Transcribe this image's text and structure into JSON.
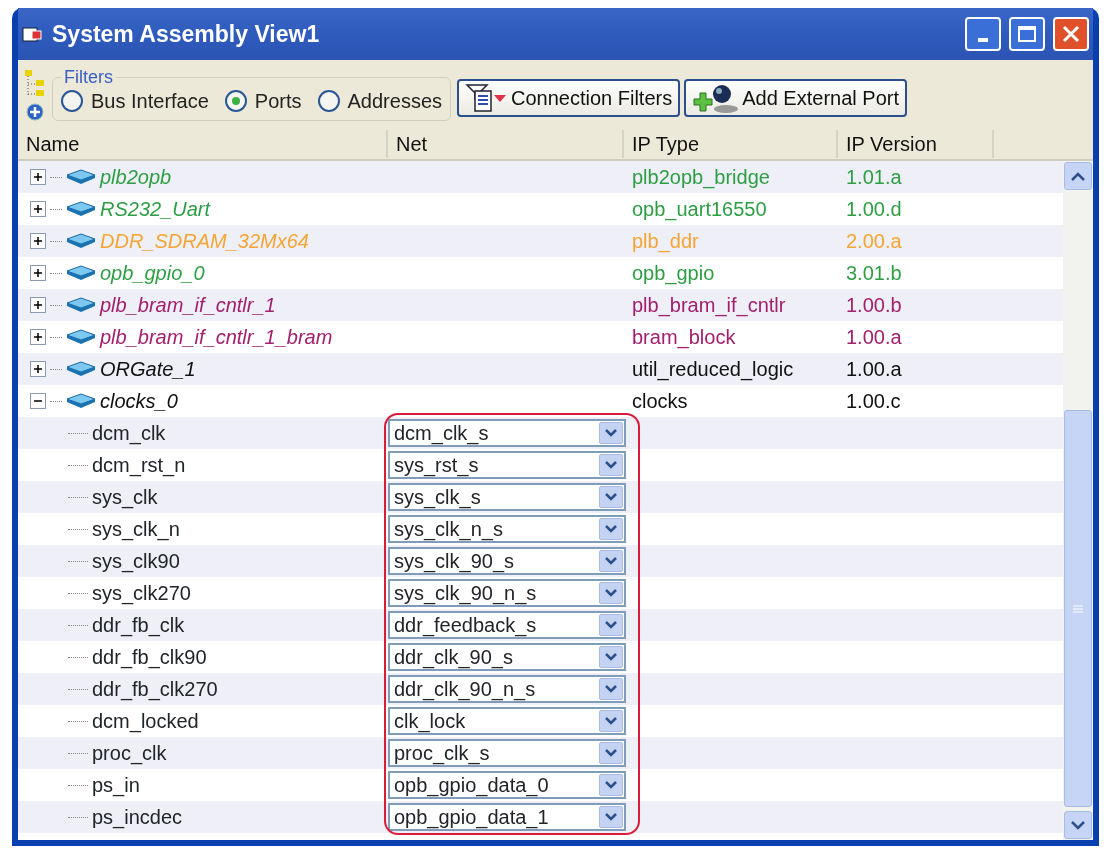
{
  "window": {
    "title": "System Assembly View1"
  },
  "filters": {
    "legend": "Filters",
    "options": [
      {
        "label": "Bus Interface",
        "selected": false
      },
      {
        "label": "Ports",
        "selected": true
      },
      {
        "label": "Addresses",
        "selected": false
      }
    ]
  },
  "toolbar_buttons": [
    {
      "label": "Connection Filters",
      "kind": "filter"
    },
    {
      "label": "Add External Port",
      "kind": "add-port"
    }
  ],
  "table": {
    "columns": [
      "Name",
      "Net",
      "IP Type",
      "IP Version"
    ],
    "rows": [
      {
        "name": "plb2opb",
        "ip_type": "plb2opb_bridge",
        "ip_version": "1.01.a",
        "color": "#2e9e44",
        "expanded": false
      },
      {
        "name": "RS232_Uart",
        "ip_type": "opb_uart16550",
        "ip_version": "1.00.d",
        "color": "#2e9e44",
        "expanded": false
      },
      {
        "name": "DDR_SDRAM_32Mx64",
        "ip_type": "plb_ddr",
        "ip_version": "2.00.a",
        "color": "#f5a533",
        "expanded": false
      },
      {
        "name": "opb_gpio_0",
        "ip_type": "opb_gpio",
        "ip_version": "3.01.b",
        "color": "#2e9e44",
        "expanded": false
      },
      {
        "name": "plb_bram_if_cntlr_1",
        "ip_type": "plb_bram_if_cntlr",
        "ip_version": "1.00.b",
        "color": "#a3206e",
        "expanded": false
      },
      {
        "name": "plb_bram_if_cntlr_1_bram",
        "ip_type": "bram_block",
        "ip_version": "1.00.a",
        "color": "#a3206e",
        "expanded": false
      },
      {
        "name": "ORGate_1",
        "ip_type": "util_reduced_logic",
        "ip_version": "1.00.a",
        "color": "#111111",
        "expanded": false
      },
      {
        "name": "clocks_0",
        "ip_type": "clocks",
        "ip_version": "1.00.c",
        "color": "#111111",
        "expanded": true,
        "children": [
          {
            "name": "dcm_clk",
            "net": "dcm_clk_s"
          },
          {
            "name": "dcm_rst_n",
            "net": "sys_rst_s"
          },
          {
            "name": "sys_clk",
            "net": "sys_clk_s"
          },
          {
            "name": "sys_clk_n",
            "net": "sys_clk_n_s"
          },
          {
            "name": "sys_clk90",
            "net": "sys_clk_90_s"
          },
          {
            "name": "sys_clk270",
            "net": "sys_clk_90_n_s"
          },
          {
            "name": "ddr_fb_clk",
            "net": "ddr_feedback_s"
          },
          {
            "name": "ddr_fb_clk90",
            "net": "ddr_clk_90_s"
          },
          {
            "name": "ddr_fb_clk270",
            "net": "ddr_clk_90_n_s"
          },
          {
            "name": "dcm_locked",
            "net": "clk_lock"
          },
          {
            "name": "proc_clk",
            "net": "proc_clk_s"
          },
          {
            "name": "ps_in",
            "net": "opb_gpio_data_0"
          },
          {
            "name": "ps_incdec",
            "net": "opb_gpio_data_1"
          }
        ]
      }
    ]
  }
}
